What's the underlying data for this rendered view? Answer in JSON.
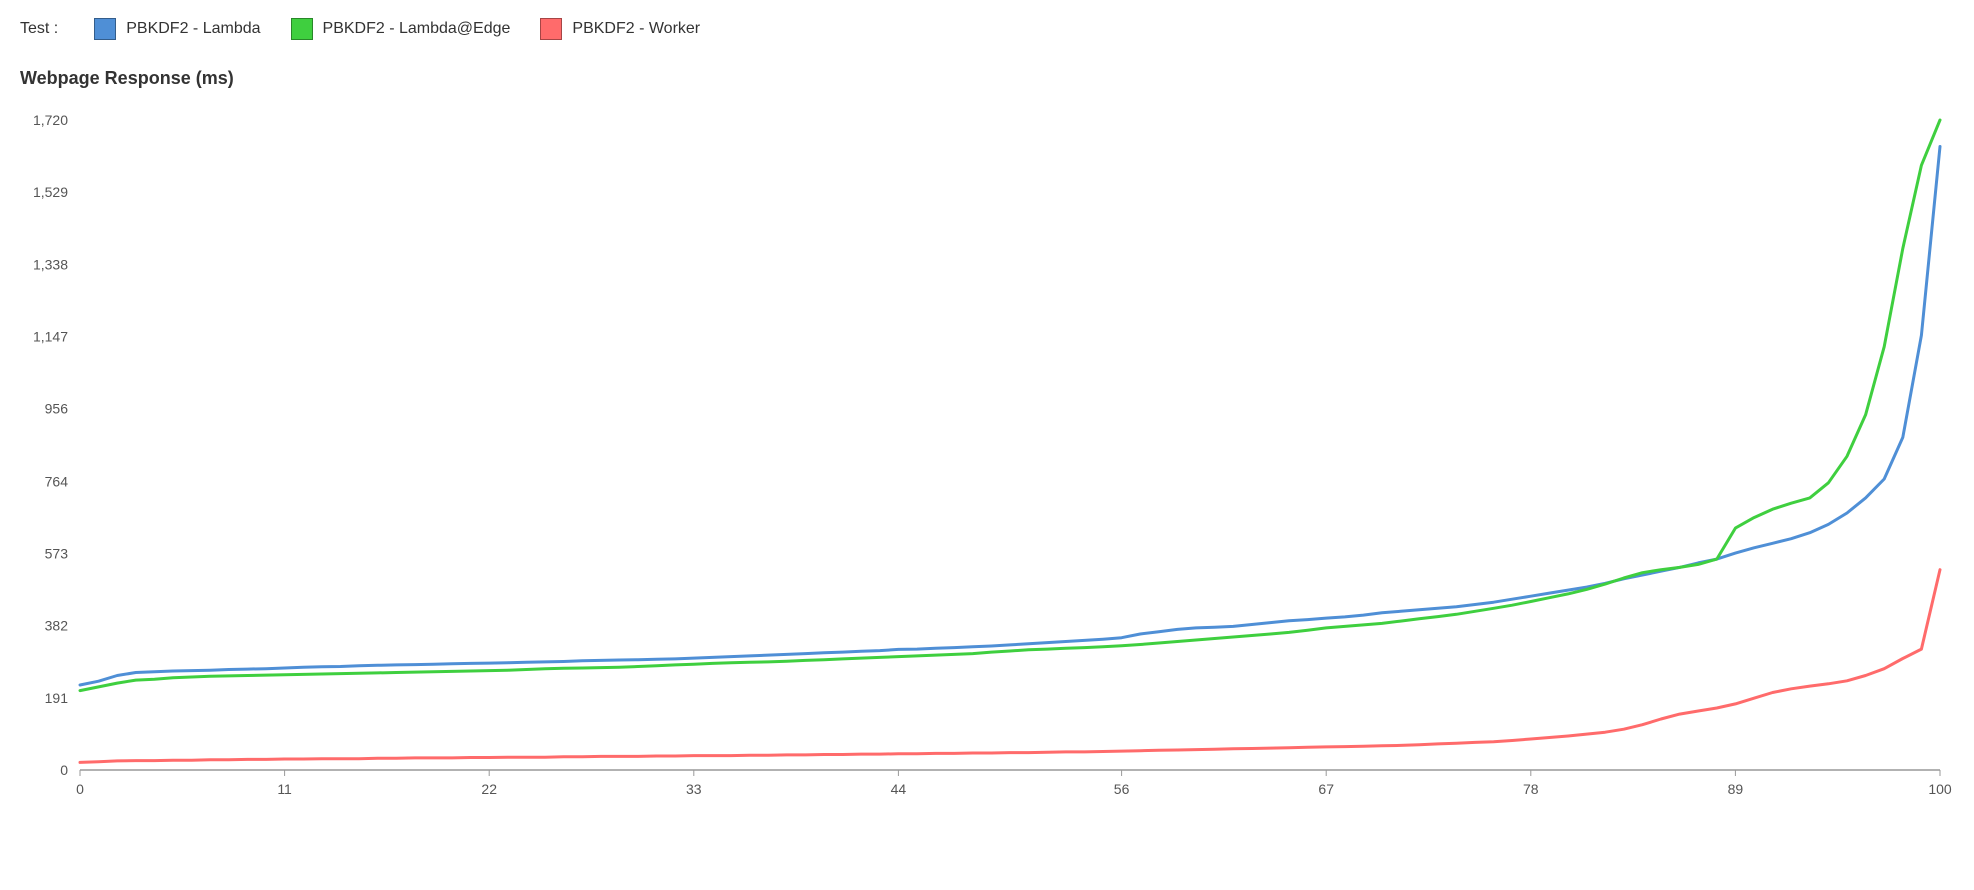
{
  "legend": {
    "prefix": "Test :",
    "items": [
      {
        "label": "PBKDF2 - Lambda",
        "color": "#4f8fd6"
      },
      {
        "label": "PBKDF2 - Lambda@Edge",
        "color": "#3fcf3f"
      },
      {
        "label": "PBKDF2 - Worker",
        "color": "#ff6b6b"
      }
    ]
  },
  "ytitle": "Webpage Response (ms)",
  "chart_data": {
    "type": "line",
    "xlabel": "",
    "ylabel": "Webpage Response (ms)",
    "xlim": [
      0,
      100
    ],
    "ylim": [
      0,
      1720
    ],
    "xticks": [
      0,
      11,
      22,
      33,
      44,
      56,
      67,
      78,
      89,
      100
    ],
    "yticks": [
      0,
      191,
      382,
      573,
      764,
      956,
      1147,
      1338,
      1529,
      1720
    ],
    "x": [
      0,
      1,
      2,
      3,
      4,
      5,
      6,
      7,
      8,
      9,
      10,
      11,
      12,
      13,
      14,
      15,
      16,
      17,
      18,
      19,
      20,
      21,
      22,
      23,
      24,
      25,
      26,
      27,
      28,
      29,
      30,
      31,
      32,
      33,
      34,
      35,
      36,
      37,
      38,
      39,
      40,
      41,
      42,
      43,
      44,
      45,
      46,
      47,
      48,
      49,
      50,
      51,
      52,
      53,
      54,
      55,
      56,
      57,
      58,
      59,
      60,
      61,
      62,
      63,
      64,
      65,
      66,
      67,
      68,
      69,
      70,
      71,
      72,
      73,
      74,
      75,
      76,
      77,
      78,
      79,
      80,
      81,
      82,
      83,
      84,
      85,
      86,
      87,
      88,
      89,
      90,
      91,
      92,
      93,
      94,
      95,
      96,
      97,
      98,
      99,
      100
    ],
    "series": [
      {
        "name": "PBKDF2 - Lambda",
        "color": "#4f8fd6",
        "values": [
          225,
          235,
          250,
          258,
          260,
          262,
          263,
          264,
          266,
          267,
          268,
          270,
          272,
          273,
          274,
          276,
          277,
          278,
          279,
          280,
          281,
          282,
          283,
          284,
          285,
          286,
          287,
          289,
          290,
          291,
          292,
          293,
          294,
          296,
          298,
          300,
          302,
          304,
          306,
          308,
          310,
          312,
          314,
          316,
          319,
          320,
          322,
          324,
          326,
          328,
          331,
          334,
          337,
          340,
          343,
          346,
          350,
          360,
          366,
          372,
          376,
          378,
          380,
          385,
          390,
          395,
          398,
          402,
          405,
          410,
          416,
          420,
          424,
          428,
          432,
          438,
          444,
          452,
          460,
          468,
          476,
          484,
          494,
          506,
          516,
          526,
          536,
          548,
          558,
          574,
          588,
          600,
          612,
          628,
          650,
          680,
          720,
          770,
          880,
          1150,
          1650
        ]
      },
      {
        "name": "PBKDF2 - Lambda@Edge",
        "color": "#3fcf3f",
        "values": [
          210,
          220,
          230,
          238,
          240,
          244,
          246,
          248,
          249,
          250,
          251,
          252,
          253,
          254,
          255,
          256,
          257,
          258,
          259,
          260,
          261,
          262,
          263,
          264,
          266,
          268,
          269,
          270,
          271,
          272,
          274,
          276,
          278,
          280,
          282,
          284,
          285,
          286,
          288,
          290,
          292,
          294,
          296,
          298,
          300,
          302,
          304,
          306,
          308,
          312,
          315,
          318,
          320,
          322,
          324,
          326,
          329,
          332,
          336,
          340,
          344,
          348,
          352,
          356,
          360,
          364,
          370,
          376,
          380,
          384,
          388,
          394,
          400,
          406,
          412,
          420,
          428,
          436,
          446,
          456,
          466,
          478,
          492,
          508,
          522,
          530,
          536,
          544,
          558,
          640,
          668,
          690,
          706,
          720,
          760,
          830,
          940,
          1120,
          1380,
          1600,
          1720
        ]
      },
      {
        "name": "PBKDF2 - Worker",
        "color": "#ff6b6b",
        "values": [
          20,
          22,
          24,
          25,
          25,
          26,
          26,
          27,
          27,
          28,
          28,
          29,
          29,
          30,
          30,
          30,
          31,
          31,
          32,
          32,
          32,
          33,
          33,
          34,
          34,
          34,
          35,
          35,
          36,
          36,
          36,
          37,
          37,
          38,
          38,
          38,
          39,
          39,
          40,
          40,
          41,
          41,
          42,
          42,
          43,
          43,
          44,
          44,
          45,
          45,
          46,
          46,
          47,
          48,
          48,
          49,
          50,
          51,
          52,
          53,
          54,
          55,
          56,
          57,
          58,
          59,
          60,
          61,
          62,
          63,
          64,
          65,
          67,
          69,
          71,
          73,
          75,
          78,
          82,
          86,
          90,
          95,
          100,
          108,
          120,
          135,
          148,
          156,
          164,
          175,
          190,
          205,
          215,
          222,
          228,
          236,
          250,
          268,
          295,
          320,
          530
        ]
      }
    ]
  }
}
